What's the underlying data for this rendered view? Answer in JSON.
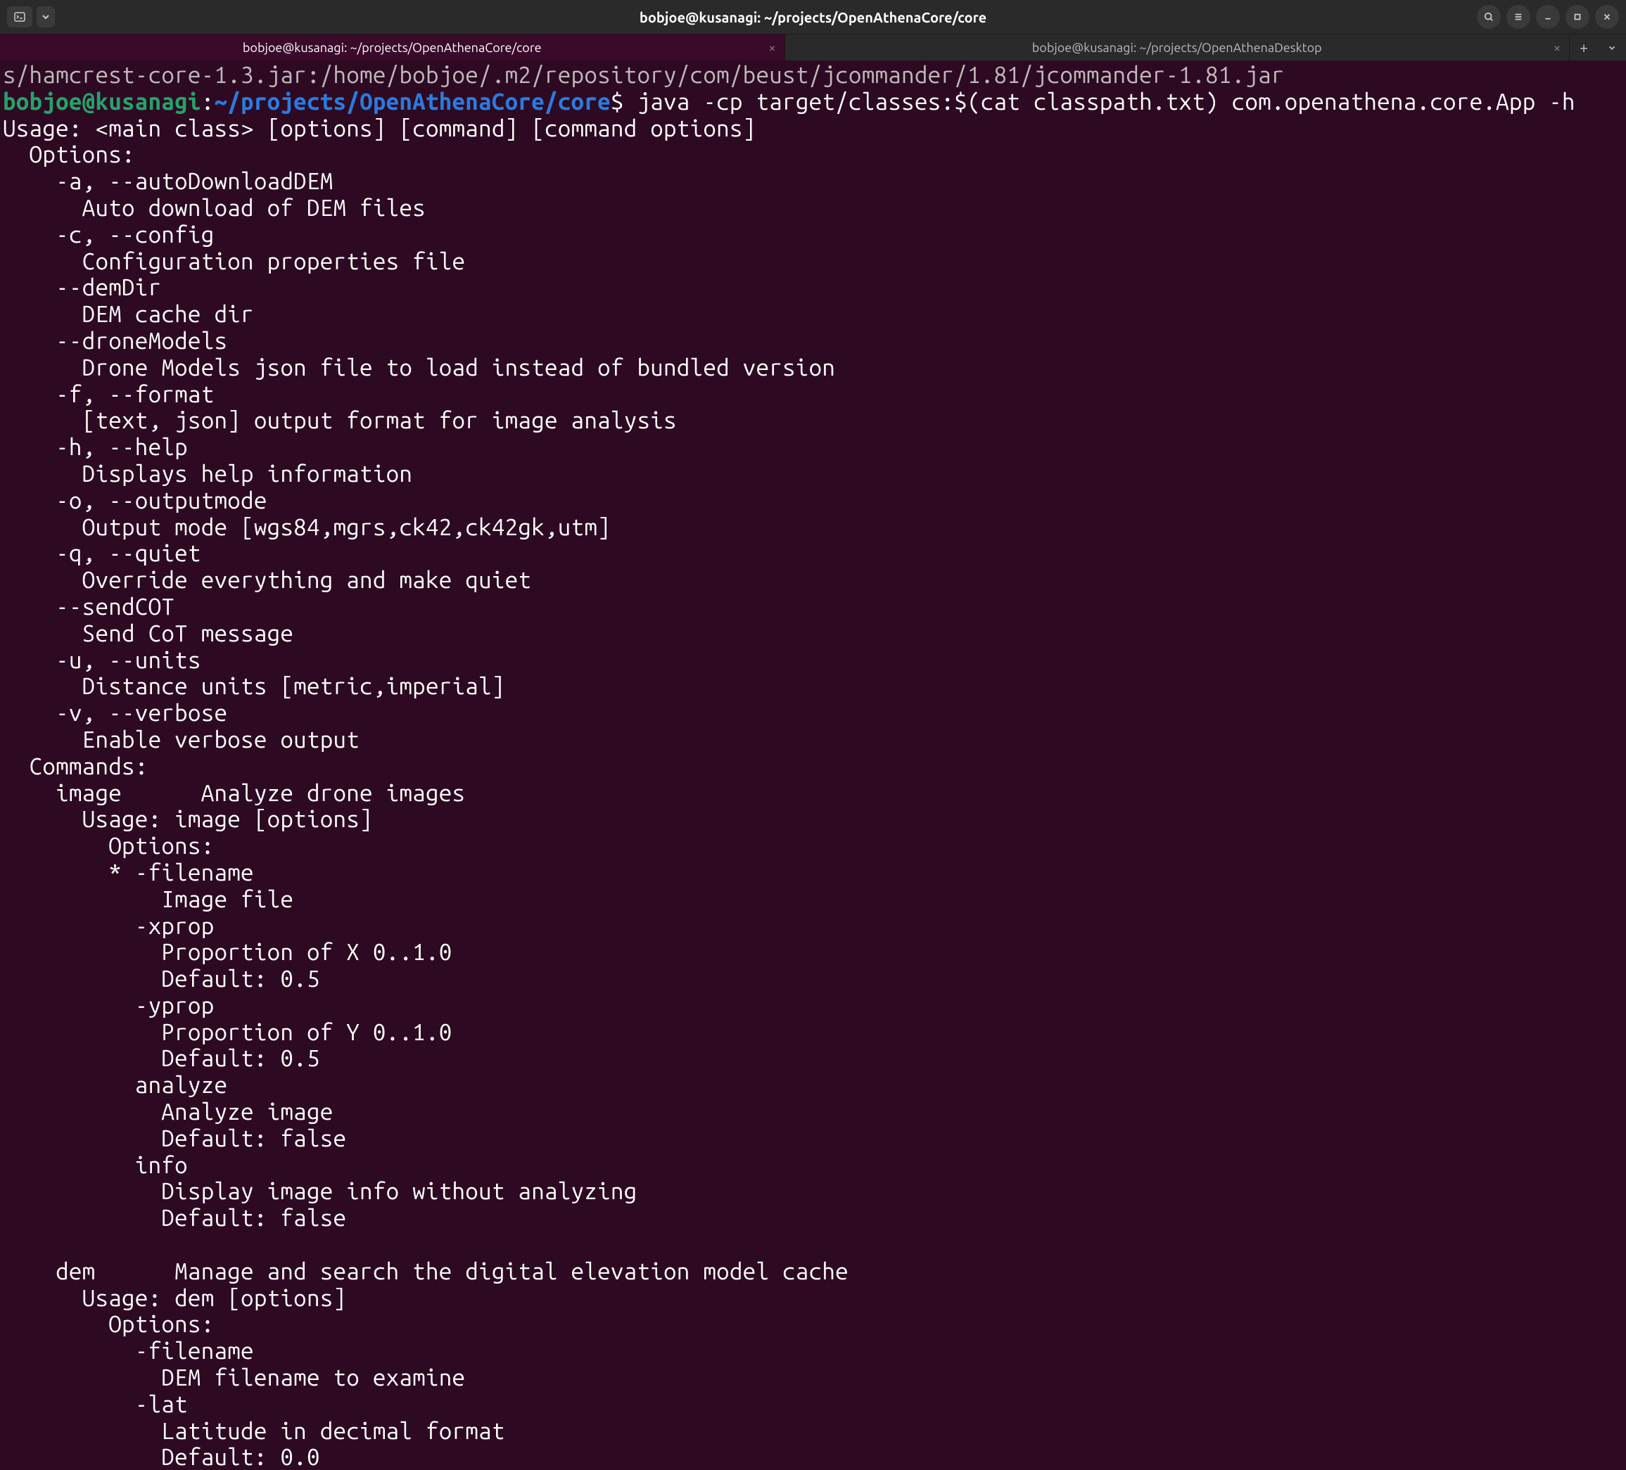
{
  "titlebar": {
    "title": "bobjoe@kusanagi: ~/projects/OpenAthenaCore/core"
  },
  "tabs": [
    {
      "label": "bobjoe@kusanagi: ~/projects/OpenAthenaCore/core",
      "active": true
    },
    {
      "label": "bobjoe@kusanagi: ~/projects/OpenAthenaDesktop",
      "active": false
    }
  ],
  "terminal": {
    "previous_line": "s/hamcrest-core-1.3.jar:/home/bobjoe/.m2/repository/com/beust/jcommander/1.81/jcommander-1.81.jar",
    "prompt": {
      "user_host": "bobjoe@kusanagi",
      "separator1": ":",
      "path": "~/projects/OpenAthenaCore/core",
      "separator2": "$"
    },
    "command": "java -cp target/classes:$(cat classpath.txt) com.openathena.core.App -h",
    "output": "Usage: <main class> [options] [command] [command options]\n  Options:\n    -a, --autoDownloadDEM\n      Auto download of DEM files\n    -c, --config\n      Configuration properties file\n    --demDir\n      DEM cache dir\n    --droneModels\n      Drone Models json file to load instead of bundled version\n    -f, --format\n      [text, json] output format for image analysis\n    -h, --help\n      Displays help information\n    -o, --outputmode\n      Output mode [wgs84,mgrs,ck42,ck42gk,utm]\n    -q, --quiet\n      Override everything and make quiet\n    --sendCOT\n      Send CoT message\n    -u, --units\n      Distance units [metric,imperial]\n    -v, --verbose\n      Enable verbose output\n  Commands:\n    image      Analyze drone images\n      Usage: image [options]\n        Options:\n        * -filename\n            Image file\n          -xprop\n            Proportion of X 0..1.0\n            Default: 0.5\n          -yprop\n            Proportion of Y 0..1.0\n            Default: 0.5\n          analyze\n            Analyze image\n            Default: false\n          info\n            Display image info without analyzing\n            Default: false\n\n    dem      Manage and search the digital elevation model cache\n      Usage: dem [options]\n        Options:\n          -filename\n            DEM filename to examine\n          -lat\n            Latitude in decimal format\n            Default: 0.0"
  }
}
